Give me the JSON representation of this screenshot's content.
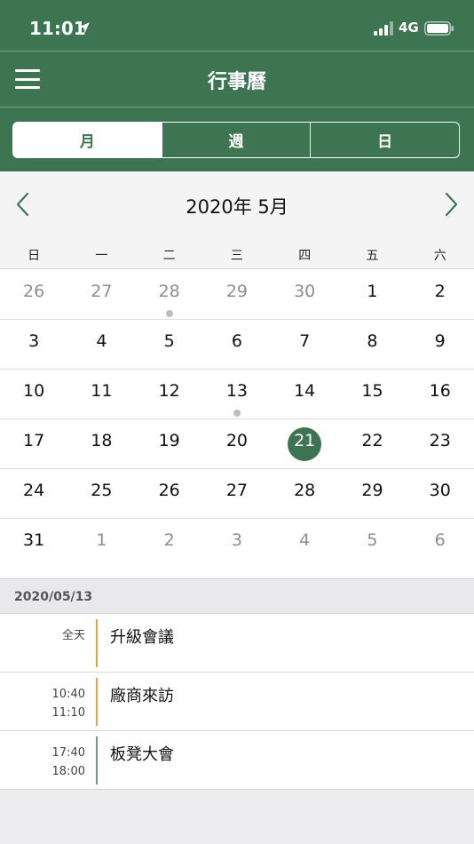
{
  "status_bar": {
    "time": "11:01",
    "network": "4G"
  },
  "nav": {
    "title": "行事曆",
    "menu_icon": "hamburger-menu-icon"
  },
  "segments": [
    {
      "label": "月",
      "active": true
    },
    {
      "label": "週",
      "active": false
    },
    {
      "label": "日",
      "active": false
    }
  ],
  "calendar": {
    "month_title": "2020年 5月",
    "weekdays": [
      "日",
      "一",
      "二",
      "三",
      "四",
      "五",
      "六"
    ],
    "weeks": [
      [
        {
          "d": "26",
          "other": true
        },
        {
          "d": "27",
          "other": true
        },
        {
          "d": "28",
          "other": true,
          "dot": true
        },
        {
          "d": "29",
          "other": true
        },
        {
          "d": "30",
          "other": true
        },
        {
          "d": "1"
        },
        {
          "d": "2"
        }
      ],
      [
        {
          "d": "3"
        },
        {
          "d": "4"
        },
        {
          "d": "5"
        },
        {
          "d": "6"
        },
        {
          "d": "7"
        },
        {
          "d": "8"
        },
        {
          "d": "9"
        }
      ],
      [
        {
          "d": "10"
        },
        {
          "d": "11"
        },
        {
          "d": "12"
        },
        {
          "d": "13",
          "dot": true
        },
        {
          "d": "14"
        },
        {
          "d": "15"
        },
        {
          "d": "16"
        }
      ],
      [
        {
          "d": "17"
        },
        {
          "d": "18"
        },
        {
          "d": "19"
        },
        {
          "d": "20"
        },
        {
          "d": "21",
          "selected": true
        },
        {
          "d": "22"
        },
        {
          "d": "23"
        }
      ],
      [
        {
          "d": "24"
        },
        {
          "d": "25"
        },
        {
          "d": "26"
        },
        {
          "d": "27"
        },
        {
          "d": "28"
        },
        {
          "d": "29"
        },
        {
          "d": "30"
        }
      ],
      [
        {
          "d": "31"
        },
        {
          "d": "1",
          "other": true
        },
        {
          "d": "2",
          "other": true
        },
        {
          "d": "3",
          "other": true
        },
        {
          "d": "4",
          "other": true
        },
        {
          "d": "5",
          "other": true
        },
        {
          "d": "6",
          "other": true
        }
      ]
    ]
  },
  "agenda": {
    "date": "2020/05/13",
    "events": [
      {
        "start": "全天",
        "end": "",
        "title": "升級會議",
        "color": "#e6a634"
      },
      {
        "start": "10:40",
        "end": "11:10",
        "title": "廠商來訪",
        "color": "#e6a634"
      },
      {
        "start": "17:40",
        "end": "18:00",
        "title": "板凳大會",
        "color": "#6e9a80"
      }
    ]
  },
  "colors": {
    "brand": "#3d7452",
    "event_orange": "#e6a634",
    "event_green": "#6e9a80"
  }
}
